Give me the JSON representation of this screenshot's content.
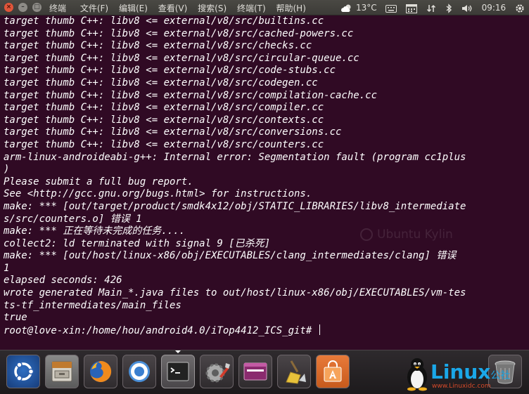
{
  "topbar": {
    "window_buttons": {
      "close_symbol": "×",
      "minimize_symbol": "–",
      "maximize_symbol": "□"
    },
    "app_title": "终端",
    "menus": [
      "文件(F)",
      "编辑(E)",
      "查看(V)",
      "搜索(S)",
      "终端(T)",
      "帮助(H)"
    ],
    "indicators": {
      "weather": "13°C",
      "weather_icon": "cloud-sun-icon",
      "keyboard_icon": "keyboard-icon",
      "calendar_icon": "calendar-icon",
      "network_icon": "network-icon",
      "bluetooth_icon": "bluetooth-icon",
      "volume_icon": "volume-icon",
      "clock": "09:16",
      "power_icon": "gear-icon"
    }
  },
  "terminal": {
    "lines": [
      "target thumb C++: libv8 <= external/v8/src/builtins.cc",
      "target thumb C++: libv8 <= external/v8/src/cached-powers.cc",
      "target thumb C++: libv8 <= external/v8/src/checks.cc",
      "target thumb C++: libv8 <= external/v8/src/circular-queue.cc",
      "target thumb C++: libv8 <= external/v8/src/code-stubs.cc",
      "target thumb C++: libv8 <= external/v8/src/codegen.cc",
      "target thumb C++: libv8 <= external/v8/src/compilation-cache.cc",
      "target thumb C++: libv8 <= external/v8/src/compiler.cc",
      "target thumb C++: libv8 <= external/v8/src/contexts.cc",
      "target thumb C++: libv8 <= external/v8/src/conversions.cc",
      "target thumb C++: libv8 <= external/v8/src/counters.cc",
      "arm-linux-androideabi-g++: Internal error: Segmentation fault (program cc1plus",
      ")",
      "Please submit a full bug report.",
      "See <http://gcc.gnu.org/bugs.html> for instructions.",
      "make: *** [out/target/product/smdk4x12/obj/STATIC_LIBRARIES/libv8_intermediate",
      "s/src/counters.o] 错误 1",
      "make: *** 正在等待未完成的任务....",
      "collect2: ld terminated with signal 9 [已杀死]",
      "make: *** [out/host/linux-x86/obj/EXECUTABLES/clang_intermediates/clang] 错误",
      "1",
      "elapsed seconds: 426",
      "wrote generated Main_*.java files to out/host/linux-x86/obj/EXECUTABLES/vm-tes",
      "ts-tf_intermediates/main_files",
      "true",
      "root@love-xin:/home/hou/android4.0/iTop4412_ICS_git# "
    ],
    "watermark": "Ubuntu Kylin"
  },
  "dock": {
    "items": [
      {
        "name": "ubuntu-kylin-launcher",
        "icon": "ubuntu-logo-icon"
      },
      {
        "name": "files",
        "icon": "file-cabinet-icon"
      },
      {
        "name": "firefox",
        "icon": "firefox-icon"
      },
      {
        "name": "chromium",
        "icon": "chromium-icon"
      },
      {
        "name": "terminal",
        "icon": "terminal-icon"
      },
      {
        "name": "system-settings",
        "icon": "settings-wrench-icon"
      },
      {
        "name": "workspace-switcher",
        "icon": "workspace-icon"
      },
      {
        "name": "janitor",
        "icon": "broom-icon"
      },
      {
        "name": "software-center",
        "icon": "shopping-bag-icon"
      },
      {
        "name": "trash",
        "icon": "trash-icon"
      }
    ],
    "brand": {
      "name": "Linux",
      "suffix": "公社",
      "url": "www.Linuxidc.com"
    }
  },
  "colors": {
    "terminal_bg": "#300a24",
    "terminal_fg": "#ffffff",
    "panel_bg": "#3c3b37",
    "close_button": "#e0553a",
    "brand_blue": "#1aa7e8"
  }
}
